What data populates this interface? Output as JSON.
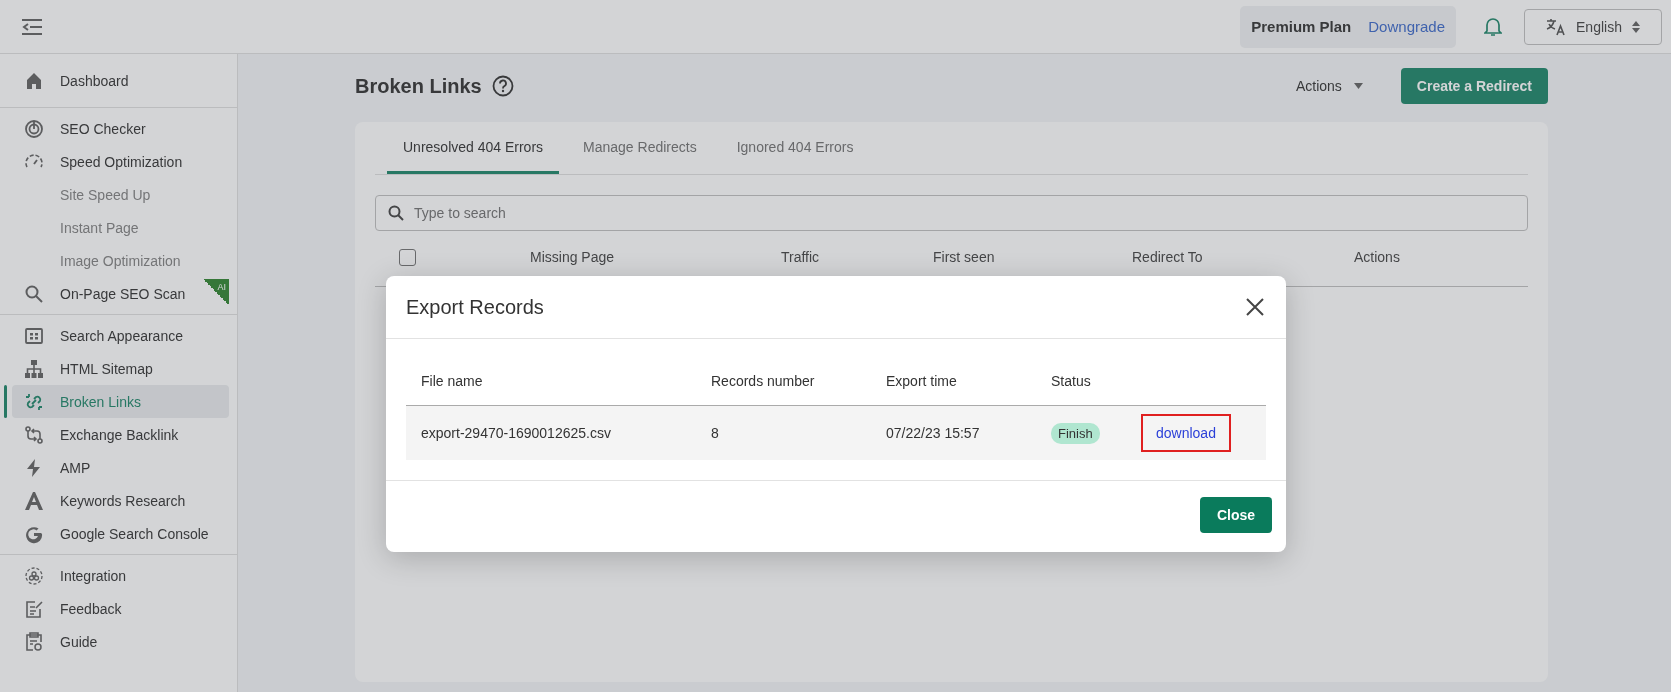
{
  "header": {
    "plan": "Premium Plan",
    "plan_link": "Downgrade",
    "language": "English"
  },
  "sidebar": {
    "groups": [
      {
        "items": [
          {
            "label": "Dashboard",
            "kind": "item",
            "selected": false
          }
        ]
      },
      {
        "items": [
          {
            "label": "SEO Checker",
            "kind": "item",
            "selected": false
          },
          {
            "label": "Speed Optimization",
            "kind": "item",
            "selected": false
          },
          {
            "label": "Site Speed Up",
            "kind": "subitem",
            "selected": false
          },
          {
            "label": "Instant Page",
            "kind": "subitem",
            "selected": false
          },
          {
            "label": "Image Optimization",
            "kind": "subitem",
            "selected": false
          },
          {
            "label": "On-Page SEO Scan",
            "kind": "item",
            "selected": false,
            "badge": "AI"
          }
        ]
      },
      {
        "items": [
          {
            "label": "Search Appearance",
            "kind": "item",
            "selected": false
          },
          {
            "label": "HTML Sitemap",
            "kind": "item",
            "selected": false
          },
          {
            "label": "Broken Links",
            "kind": "item",
            "selected": true
          },
          {
            "label": "Exchange Backlink",
            "kind": "item",
            "selected": false
          },
          {
            "label": "AMP",
            "kind": "item",
            "selected": false
          },
          {
            "label": "Keywords Research",
            "kind": "item",
            "selected": false
          },
          {
            "label": "Google Search Console",
            "kind": "item",
            "selected": false
          }
        ]
      },
      {
        "items": [
          {
            "label": "Integration",
            "kind": "item",
            "selected": false
          },
          {
            "label": "Feedback",
            "kind": "item",
            "selected": false
          },
          {
            "label": "Guide",
            "kind": "item",
            "selected": false
          }
        ]
      }
    ]
  },
  "page": {
    "title": "Broken Links",
    "actions": "Actions",
    "primary_button": "Create a Redirect"
  },
  "tabs": [
    {
      "label": "Unresolved 404 Errors",
      "selected": true
    },
    {
      "label": "Manage Redirects",
      "selected": false
    },
    {
      "label": "Ignored 404 Errors",
      "selected": false
    }
  ],
  "search": {
    "placeholder": "Type to search"
  },
  "table": {
    "checked": false,
    "columns": [
      "Missing Page",
      "Traffic",
      "First seen",
      "Redirect To",
      "Actions"
    ]
  },
  "modal": {
    "title": "Export Records",
    "columns": [
      "File name",
      "Records number",
      "Export time",
      "Status"
    ],
    "rows": [
      {
        "file": "export-29470-1690012625.csv",
        "records": "8",
        "time": "07/22/23 15:57",
        "status": "Finish",
        "action": "download",
        "highlighted": true
      }
    ],
    "button": "Close"
  }
}
